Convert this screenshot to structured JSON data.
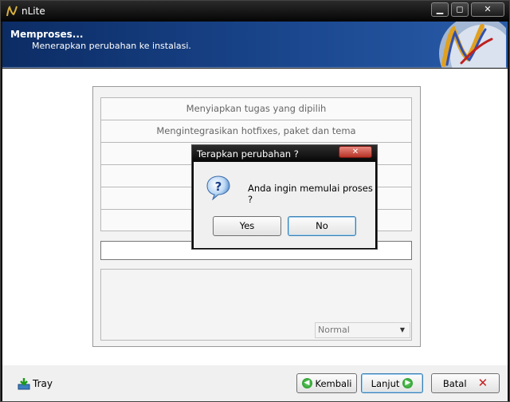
{
  "window": {
    "title": "nLite",
    "controls": {
      "minimize": "▁",
      "maximize": "◻",
      "close": "✕"
    }
  },
  "header": {
    "title": "Memproses...",
    "subtitle": "Menerapkan perubahan ke instalasi."
  },
  "tasks": [
    "Menyiapkan tugas yang dipilih",
    "Mengintegrasikan hotfixes, paket dan tema",
    "",
    "",
    "",
    ""
  ],
  "priority": {
    "selected": "Normal"
  },
  "bottom": {
    "tray_label": "Tray",
    "back_label": "Kembali",
    "next_label": "Lanjut",
    "cancel_label": "Batal"
  },
  "dialog": {
    "title": "Terapkan perubahan ?",
    "message": "Anda ingin memulai proses ?",
    "yes_label": "Yes",
    "no_label": "No"
  },
  "colors": {
    "header_bg": "#1b4890",
    "accent_green": "#1a8a1a",
    "cancel_red": "#c62020"
  }
}
